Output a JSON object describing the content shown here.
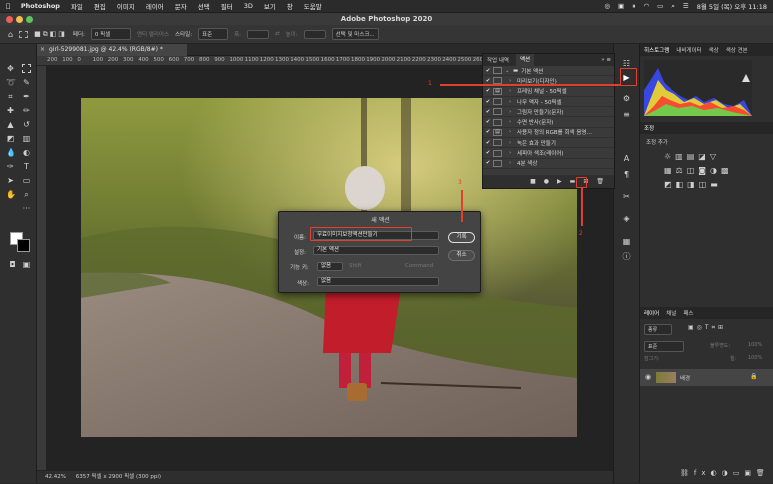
{
  "menubar": {
    "app": "Photoshop",
    "items": [
      "파일",
      "편집",
      "이미지",
      "레이어",
      "문자",
      "선택",
      "필터",
      "3D",
      "보기",
      "창",
      "도움말"
    ],
    "clock": "8월 5일 (목) 오후 11:18"
  },
  "window_title": "Adobe Photoshop 2020",
  "options": {
    "feather_label": "페더:",
    "feather_value": "0 픽셀",
    "antialias": "앤티 앨리어스",
    "style_label": "스타일:",
    "style_value": "표준",
    "width_label": "폭:",
    "height_label": "높이:",
    "select_mask": "선택 및 마스크..."
  },
  "document_tab": "girl-5299081.jpg @ 42.4% (RGB/8#) *",
  "ruler_ticks": [
    "200",
    "100",
    "0",
    "100",
    "200",
    "300",
    "400",
    "500",
    "600",
    "700",
    "800",
    "900",
    "1000",
    "1100",
    "1200",
    "1300",
    "1400",
    "1500",
    "1600",
    "1700",
    "1800",
    "1900",
    "2000",
    "2100",
    "2200",
    "2300",
    "2400",
    "2500",
    "2600",
    "2700",
    "2800",
    "2900",
    "3000",
    "3100",
    "3200",
    "3300",
    "3400"
  ],
  "status": {
    "zoom": "42.42%",
    "size": "6357 픽셀 x 2900 픽셀 (300 ppi)"
  },
  "actions_panel": {
    "tabs": [
      "작업 내역",
      "액션"
    ],
    "rows": [
      {
        "label": "기본 액션",
        "folder": true,
        "toggle": ""
      },
      {
        "label": "미리보기(디자인)",
        "folder": false,
        "toggle": ""
      },
      {
        "label": "프레임 채널 - 50픽셀",
        "folder": false,
        "toggle": "▤"
      },
      {
        "label": "나무 액자 - 50픽셀",
        "folder": false,
        "toggle": ""
      },
      {
        "label": "그림자 만들기(문자)",
        "folder": false,
        "toggle": ""
      },
      {
        "label": "수면 반사(문자)",
        "folder": false,
        "toggle": ""
      },
      {
        "label": "사용자 정의 RGB를 회색 음영…",
        "folder": false,
        "toggle": "▤"
      },
      {
        "label": "녹은 효과 만들기",
        "folder": false,
        "toggle": ""
      },
      {
        "label": "세피아 색조(레이어)",
        "folder": false,
        "toggle": ""
      },
      {
        "label": "4분 색상",
        "folder": false,
        "toggle": ""
      }
    ]
  },
  "dialog": {
    "title": "새 액션",
    "name_label": "이름:",
    "name_value": "무료이미지보정액션만들기",
    "set_label": "설정:",
    "set_value": "기본 액션",
    "fkey_label": "기능 키:",
    "fkey_value": "없음",
    "shift": "Shift",
    "command": "Command",
    "color_label": "색상:",
    "color_value": "없음",
    "record": "기록",
    "cancel": "취소"
  },
  "annotations": [
    "1",
    "2",
    "3"
  ],
  "right_panel": {
    "top_tabs": [
      "히스토그램",
      "내비게이터",
      "색상",
      "색상 견본"
    ],
    "adj_tab": "조정",
    "adj_add": "조정 추가",
    "layer_tabs": [
      "레이어",
      "채널",
      "패스"
    ],
    "layer_kind": "종류",
    "blend": "표준",
    "opacity": "불투명도:",
    "opacity_val": "100%",
    "lock": "잠그기:",
    "fill": "칠:",
    "fill_val": "100%",
    "layer_name": "배경"
  },
  "colors": {
    "accent": "#e1402e",
    "panel": "#2f2f2f",
    "dialog": "#444444"
  }
}
